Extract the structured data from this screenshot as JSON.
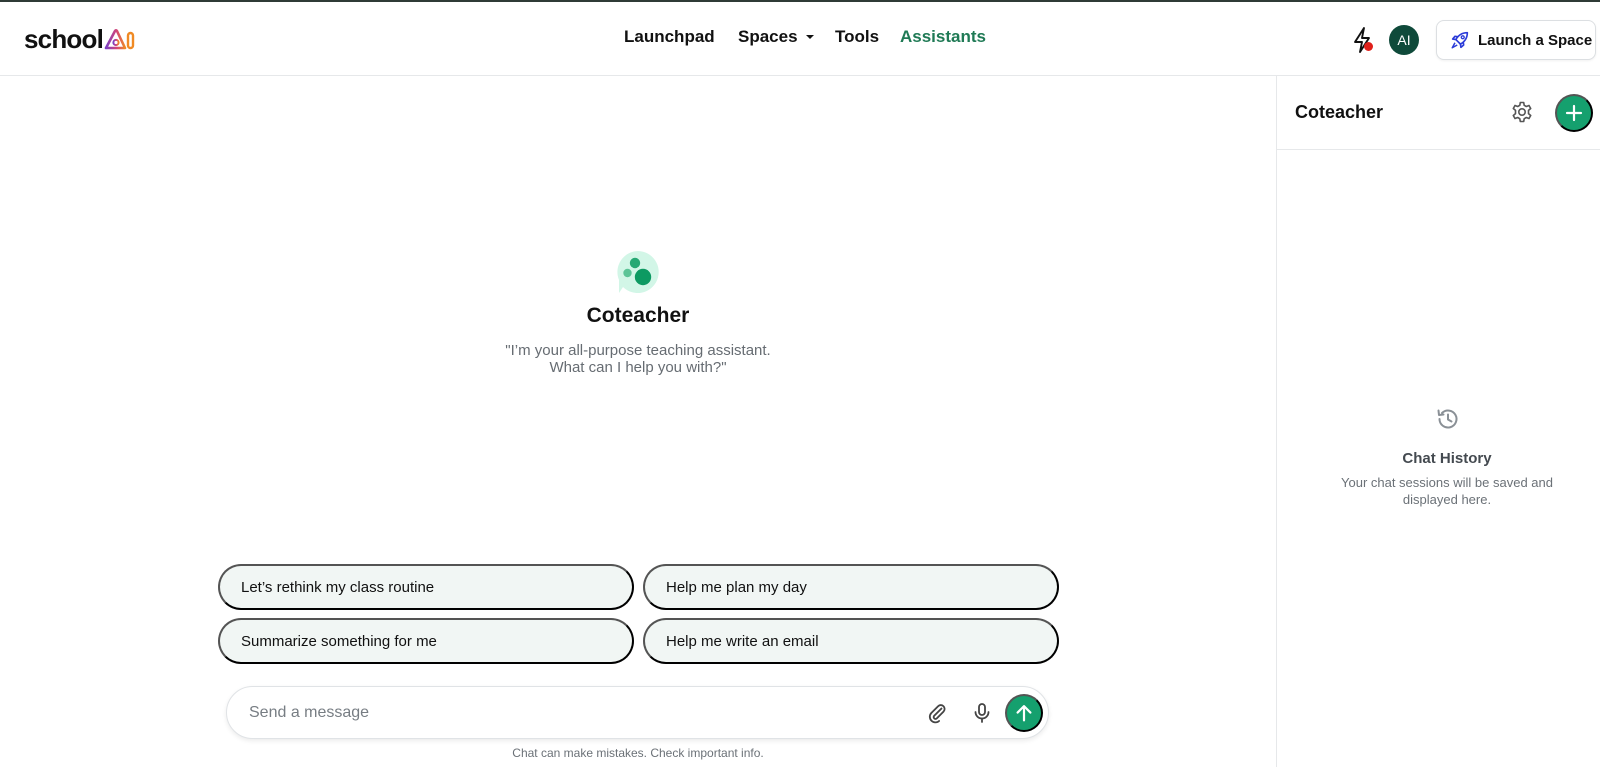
{
  "header": {
    "logo_text": "school",
    "nav": [
      {
        "label": "Launchpad"
      },
      {
        "label": "Spaces"
      },
      {
        "label": "Tools"
      },
      {
        "label": "Assistants"
      }
    ],
    "active_nav": "Assistants",
    "avatar_initials": "AI",
    "launch_button_label": "Launch a Space",
    "notification_indicator": true
  },
  "assistant": {
    "name": "Coteacher",
    "description": "\"I’m your all-purpose teaching assistant. What can I help you with?\""
  },
  "suggestions": [
    {
      "label": "Let’s rethink my class routine"
    },
    {
      "label": "Help me plan my day"
    },
    {
      "label": "Summarize something for me"
    },
    {
      "label": "Help me write an email"
    }
  ],
  "composer": {
    "placeholder": "Send a message",
    "value": "",
    "disclaimer": "Chat can make mistakes. Check important info."
  },
  "panel": {
    "title": "Coteacher",
    "history_title": "Chat History",
    "history_desc": "Your chat sessions will be saved and displayed here."
  },
  "colors": {
    "accent": "#15a06e",
    "nav_active": "#1f7a55",
    "avatar_bg": "#0f4a3a",
    "suggestion_bg": "#f1f6f4",
    "notification": "#e0201b"
  },
  "icons": [
    "bolt-icon",
    "rocket-icon",
    "assistant-bubble-icon",
    "paperclip-icon",
    "microphone-icon",
    "arrow-up-icon",
    "gear-icon",
    "plus-icon",
    "history-icon"
  ]
}
